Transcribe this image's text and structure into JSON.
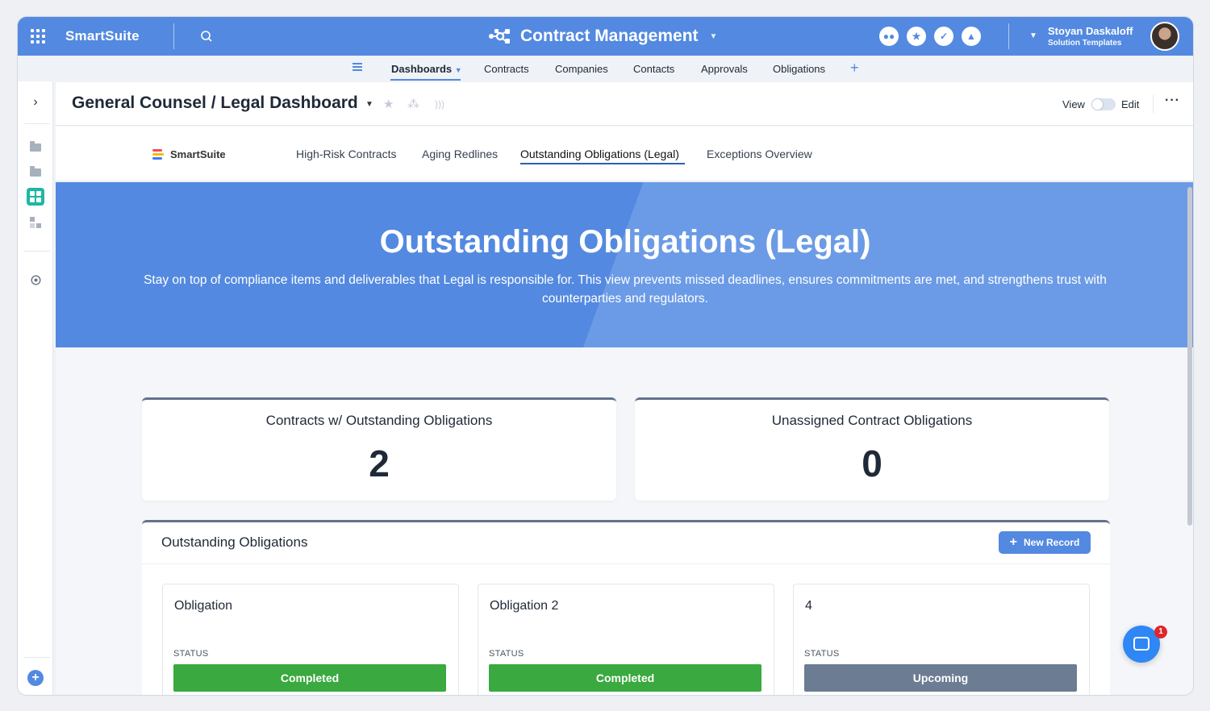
{
  "topbar": {
    "brand": "SmartSuite",
    "app_title": "Contract Management",
    "user_name": "Stoyan Daskaloff",
    "user_subtitle": "Solution Templates",
    "icons": [
      "members-icon",
      "star-icon",
      "check-icon",
      "bell-icon"
    ]
  },
  "nav": {
    "items": [
      "Dashboards",
      "Contracts",
      "Companies",
      "Contacts",
      "Approvals",
      "Obligations"
    ],
    "active": "Dashboards"
  },
  "header": {
    "title": "General Counsel / Legal Dashboard",
    "view_label": "View",
    "edit_label": "Edit"
  },
  "tabs": {
    "logo_text": "SmartSuite",
    "items": [
      "High-Risk Contracts",
      "Aging Redlines",
      "Outstanding Obligations (Legal)",
      "Exceptions Overview"
    ],
    "active": "Outstanding Obligations (Legal)"
  },
  "hero": {
    "title": "Outstanding Obligations (Legal)",
    "description": "Stay on top of compliance items and deliverables that Legal is responsible for. This view prevents missed deadlines, ensures commitments are met, and strengthens trust with counterparties and regulators."
  },
  "kpis": [
    {
      "label": "Contracts w/ Outstanding Obligations",
      "value": "2"
    },
    {
      "label": "Unassigned Contract Obligations",
      "value": "0"
    }
  ],
  "panel": {
    "title": "Outstanding Obligations",
    "new_record": "New Record",
    "cards": [
      {
        "title": "Obligation",
        "status_label": "STATUS",
        "status": "Completed",
        "status_color": "#3aa93f"
      },
      {
        "title": "Obligation 2",
        "status_label": "STATUS",
        "status": "Completed",
        "status_color": "#3aa93f"
      },
      {
        "title": "4",
        "status_label": "STATUS",
        "status": "Upcoming",
        "status_color": "#6b7c93"
      }
    ]
  },
  "chat_badge": "1",
  "colors": {
    "accent": "#5389e0",
    "teal": "#1fb6a4",
    "completed": "#3aa93f",
    "upcoming": "#6b7c93"
  }
}
